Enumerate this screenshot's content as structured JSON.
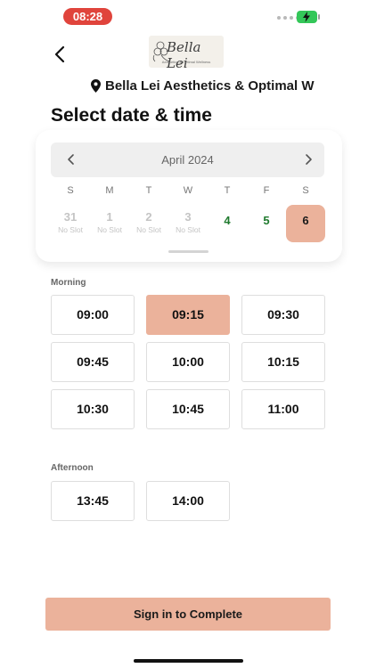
{
  "status_bar": {
    "time": "08:28"
  },
  "header": {
    "logo_script": "Bella Lei",
    "logo_tagline": "Aesthetics & Optimal Wellness"
  },
  "location": {
    "name": "Bella Lei Aesthetics & Optimal W"
  },
  "page_title": "Select date & time",
  "calendar": {
    "month": "April 2024",
    "weekdays": [
      "S",
      "M",
      "T",
      "W",
      "T",
      "F",
      "S"
    ],
    "days": [
      {
        "num": "31",
        "sub": "No Slot"
      },
      {
        "num": "1",
        "sub": "No Slot"
      },
      {
        "num": "2",
        "sub": "No Slot"
      },
      {
        "num": "3",
        "sub": "No Slot"
      },
      {
        "num": "4",
        "sub": ""
      },
      {
        "num": "5",
        "sub": ""
      },
      {
        "num": "6",
        "sub": ""
      }
    ],
    "selected_day": "6",
    "accent_color": "#ebb29b",
    "available_color": "#1f7a2e"
  },
  "morning": {
    "label": "Morning",
    "slots": [
      "09:00",
      "09:15",
      "09:30",
      "09:45",
      "10:00",
      "10:15",
      "10:30",
      "10:45",
      "11:00"
    ],
    "selected": "09:15"
  },
  "afternoon": {
    "label": "Afternoon",
    "slots": [
      "13:45",
      "14:00"
    ]
  },
  "cta": {
    "label": "Sign in to Complete"
  }
}
